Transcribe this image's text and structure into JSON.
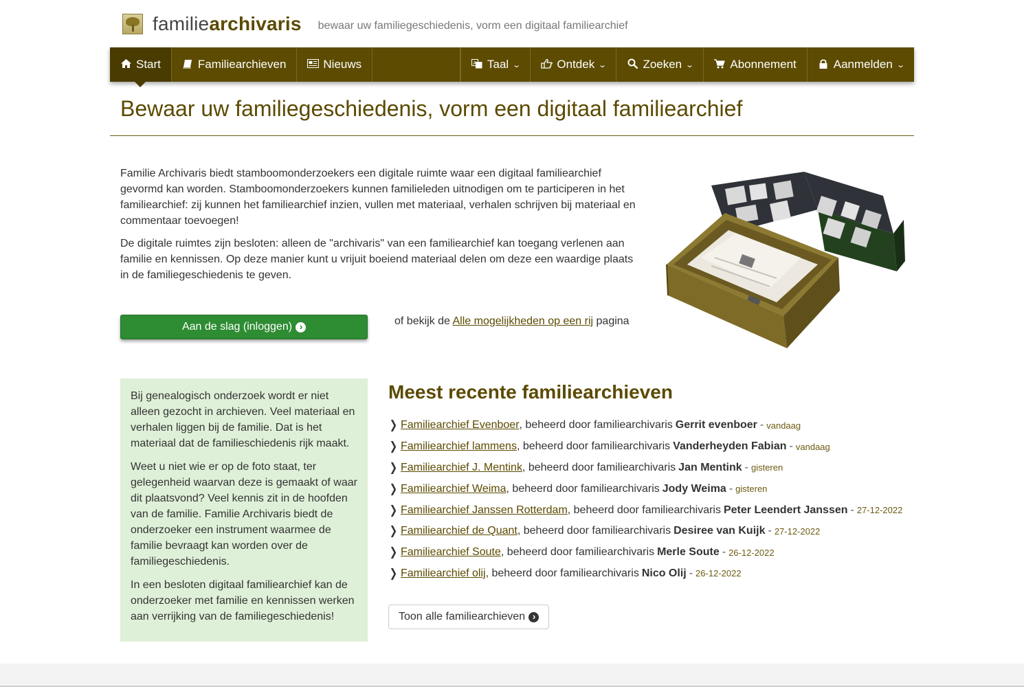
{
  "brand": {
    "name_light": "familie",
    "name_bold": "archivaris",
    "tagline": "bewaar uw familiegeschiedenis, vorm een digitaal familiearchief"
  },
  "nav": {
    "start": "Start",
    "familiearchieven": "Familiearchieven",
    "nieuws": "Nieuws",
    "taal": "Taal",
    "ontdek": "Ontdek",
    "zoeken": "Zoeken",
    "abonnement": "Abonnement",
    "aanmelden": "Aanmelden"
  },
  "page": {
    "title": "Bewaar uw familiegeschiedenis, vorm een digitaal familiearchief",
    "intro_p1": "Familie Archivaris biedt stamboomonderzoekers een digitale ruimte waar een digitaal familiearchief gevormd kan worden. Stamboomonderzoekers kunnen familieleden uitnodigen om te participeren in het familiearchief: zij kunnen het familiearchief inzien, vullen met materiaal, verhalen schrijven bij materiaal en commentaar toevoegen!",
    "intro_p2": "De digitale ruimtes zijn besloten: alleen de \"archivaris\" van een familiearchief kan toegang verlenen aan familie en kennissen. Op deze manier kunt u vrijuit boeiend materiaal delen om deze een waardige plaats in de familiegeschiedenis te geven.",
    "cta_label": "Aan de slag (inloggen)",
    "alt_prefix": "of bekijk de",
    "alt_link": "Alle mogelijkheden op een rij",
    "alt_suffix": "pagina"
  },
  "sidebar": {
    "p1": "Bij genealogisch onderzoek wordt er niet alleen gezocht in archieven. Veel materiaal en verhalen liggen bij de familie. Dat is het materiaal dat de familieschiedenis rijk maakt.",
    "p2": "Weet u niet wie er op de foto staat, ter gelegenheid waarvan deze is gemaakt of waar dit plaatsvond? Veel kennis zit in de hoofden van de familie. Familie Archivaris biedt de onderzoeker een instrument waarmee de familie bevraagt kan worden over de familiegeschiedenis.",
    "p3": "In een besloten digitaal familiearchief kan de onderzoeker met familie en kennissen werken aan verrijking van de familiegeschiedenis!"
  },
  "recent": {
    "title": "Meest recente familiearchieven",
    "managed_by": ", beheerd door familiearchivaris",
    "items": [
      {
        "archive": "Familiearchief Evenboer",
        "owner": "Gerrit evenboer",
        "when": "vandaag"
      },
      {
        "archive": "Familiearchief lammens",
        "owner": "Vanderheyden Fabian",
        "when": "vandaag"
      },
      {
        "archive": "Familiearchief J. Mentink",
        "owner": "Jan Mentink",
        "when": "gisteren"
      },
      {
        "archive": "Familiearchief Weima",
        "owner": "Jody Weima",
        "when": "gisteren"
      },
      {
        "archive": "Familiearchief Janssen Rotterdam",
        "owner": "Peter Leendert Janssen",
        "when": "27-12-2022"
      },
      {
        "archive": "Familiearchief de Quant",
        "owner": "Desiree van Kuijk",
        "when": "27-12-2022"
      },
      {
        "archive": "Familiearchief Soute",
        "owner": "Merle Soute",
        "when": "26-12-2022"
      },
      {
        "archive": "Familiearchief olij",
        "owner": "Nico Olij",
        "when": "26-12-2022"
      }
    ],
    "show_all": "Toon alle familiearchieven"
  },
  "colors": {
    "brand_olive": "#5c4b00",
    "cta_green": "#2e8c33",
    "sidebar_bg": "#dff0d8"
  },
  "icons": {
    "start": "home-icon",
    "familiearchieven": "book-icon",
    "nieuws": "newspaper-icon",
    "taal": "language-icon",
    "ontdek": "hand-pointer-icon",
    "zoeken": "search-icon",
    "abonnement": "cart-icon",
    "aanmelden": "lock-icon"
  }
}
